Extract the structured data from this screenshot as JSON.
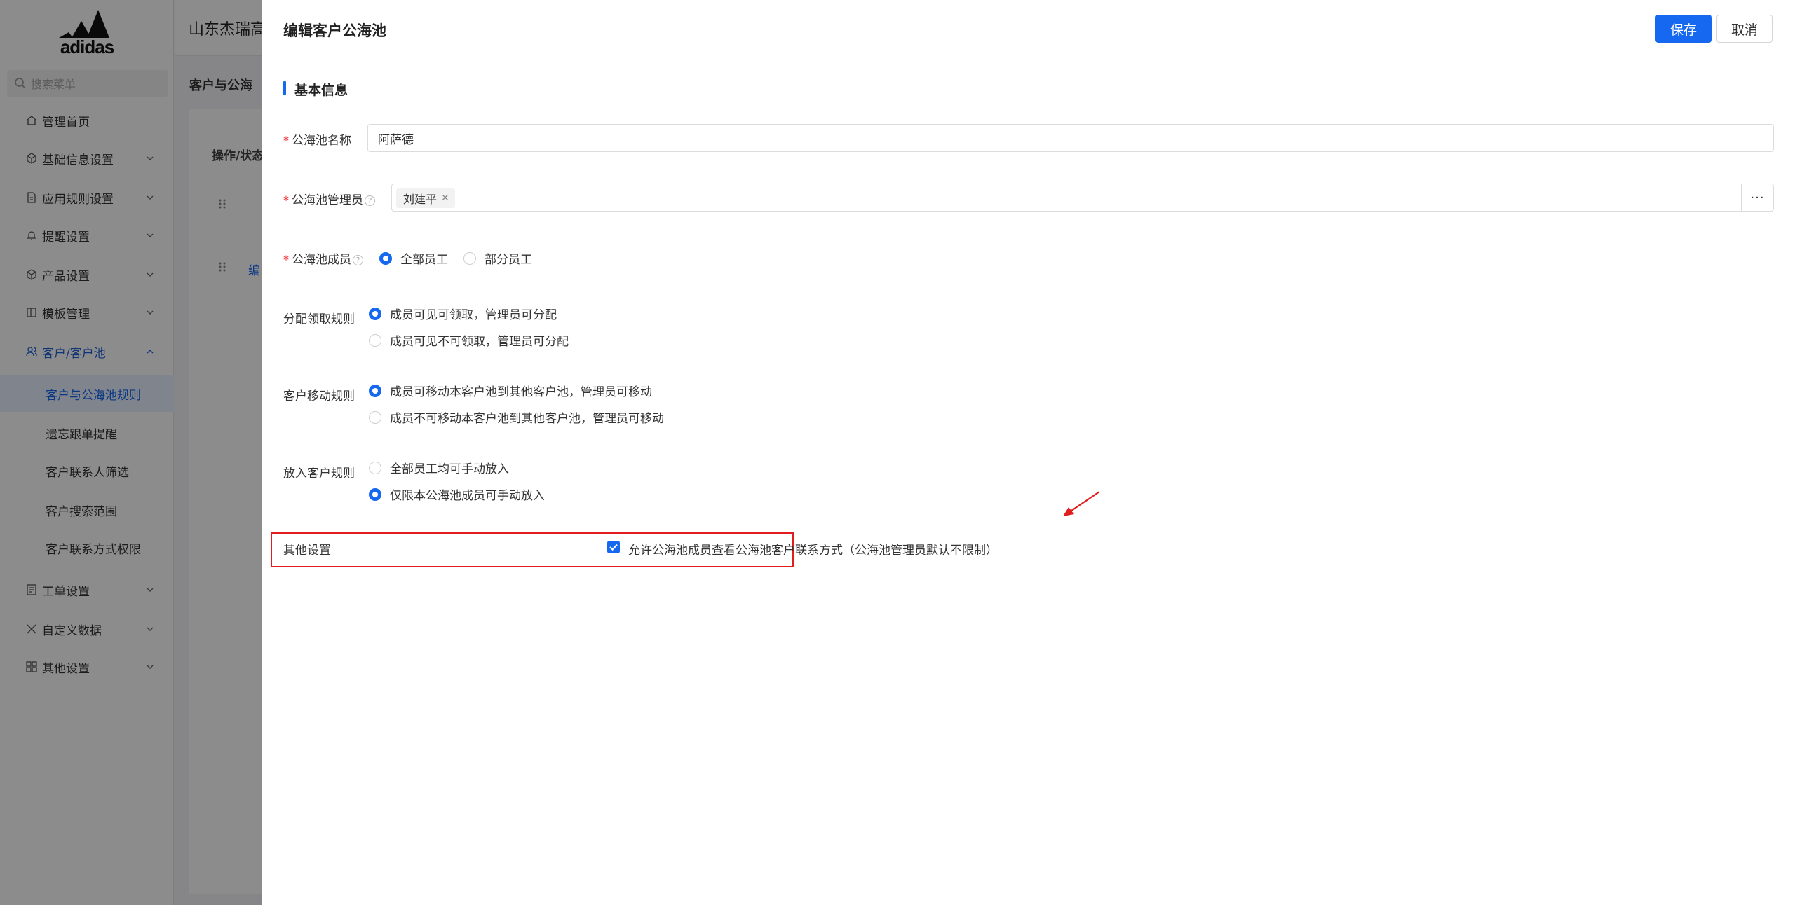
{
  "sidebar": {
    "logo_text": "adidas",
    "search_placeholder": "搜索菜单",
    "items": [
      {
        "label": "管理首页"
      },
      {
        "label": "基础信息设置"
      },
      {
        "label": "应用规则设置"
      },
      {
        "label": "提醒设置"
      },
      {
        "label": "产品设置"
      },
      {
        "label": "模板管理"
      },
      {
        "label": "客户/客户池"
      },
      {
        "label": "客户与公海池规则"
      },
      {
        "label": "遗忘跟单提醒"
      },
      {
        "label": "客户联系人筛选"
      },
      {
        "label": "客户搜索范围"
      },
      {
        "label": "客户联系方式权限"
      },
      {
        "label": "工单设置"
      },
      {
        "label": "自定义数据"
      },
      {
        "label": "其他设置"
      }
    ]
  },
  "topbar": {
    "title": "山东杰瑞高"
  },
  "background": {
    "tab_title": "客户与公海",
    "col_header": "操作/状态",
    "edit_link": "编"
  },
  "drawer": {
    "title": "编辑客户公海池",
    "save_label": "保存",
    "cancel_label": "取消",
    "section_title": "基本信息",
    "pool_name": {
      "label": "公海池名称",
      "value": "阿萨德"
    },
    "pool_manager": {
      "label": "公海池管理员",
      "tag": "刘建平",
      "more": "···"
    },
    "pool_members": {
      "label": "公海池成员",
      "options": [
        "全部员工",
        "部分员工"
      ],
      "selected": 0
    },
    "claim_rule": {
      "label": "分配领取规则",
      "options": [
        "成员可见可领取，管理员可分配",
        "成员可见不可领取，管理员可分配"
      ],
      "selected": 0
    },
    "move_rule": {
      "label": "客户移动规则",
      "options": [
        "成员可移动本客户池到其他客户池，管理员可移动",
        "成员不可移动本客户池到其他客户池，管理员可移动"
      ],
      "selected": 0
    },
    "put_rule": {
      "label": "放入客户规则",
      "options": [
        "全部员工均可手动放入",
        "仅限本公海池成员可手动放入"
      ],
      "selected": 1
    },
    "other": {
      "label": "其他设置",
      "checkbox_label": "允许公海池成员查看公海池客户联系方式（公海池管理员默认不限制）",
      "checked": true
    }
  },
  "colors": {
    "primary": "#1668f0",
    "highlight_border": "#e11d1d",
    "required": "#f5222d"
  }
}
